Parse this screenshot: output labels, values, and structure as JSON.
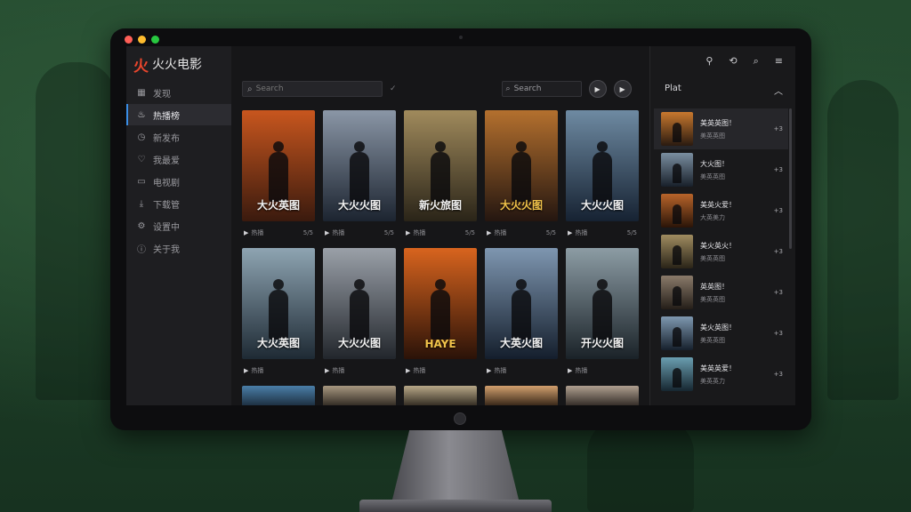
{
  "app": {
    "brand_icon": "flame-logo-icon",
    "brand_name": "火火电影"
  },
  "window": {
    "traffic_colors": [
      "#ff5f57",
      "#febc2e",
      "#28c840"
    ]
  },
  "sidebar": {
    "items": [
      {
        "label": "发现",
        "icon": "grid-icon",
        "active": false
      },
      {
        "label": "热播榜",
        "icon": "fire-icon",
        "active": true
      },
      {
        "label": "新发布",
        "icon": "clock-icon",
        "active": false
      },
      {
        "label": "我最爱",
        "icon": "heart-icon",
        "active": false
      },
      {
        "label": "电视剧",
        "icon": "tv-icon",
        "active": false
      },
      {
        "label": "下载管",
        "icon": "download-icon",
        "active": false
      },
      {
        "label": "设置中",
        "icon": "settings-icon",
        "active": false
      },
      {
        "label": "关于我",
        "icon": "info-icon",
        "active": false
      }
    ]
  },
  "toolbar": {
    "search_placeholder": "Search",
    "search2_placeholder": "Search",
    "check_icon": "✓"
  },
  "movies": [
    {
      "title": "大火英图",
      "meta_left": "热播",
      "meta_right": "5/5",
      "gold": false,
      "bg": [
        "#c8561e",
        "#3a1a0e"
      ]
    },
    {
      "title": "大火火图",
      "meta_left": "热播",
      "meta_right": "5/5",
      "gold": false,
      "bg": [
        "#8a96a6",
        "#1c2430"
      ]
    },
    {
      "title": "新火旅图",
      "meta_left": "热播",
      "meta_right": "5/5",
      "gold": false,
      "bg": [
        "#a08a5c",
        "#2a2418"
      ]
    },
    {
      "title": "大火火图",
      "meta_left": "热播",
      "meta_right": "5/5",
      "gold": true,
      "bg": [
        "#b4702e",
        "#241610"
      ]
    },
    {
      "title": "大火火图",
      "meta_left": "热播",
      "meta_right": "5/5",
      "gold": false,
      "bg": [
        "#6e8aa2",
        "#162232"
      ]
    },
    {
      "title": "大火英图",
      "meta_left": "热播",
      "meta_right": "",
      "gold": false,
      "bg": [
        "#8ea4b2",
        "#1e2a34"
      ]
    },
    {
      "title": "大火火图",
      "meta_left": "热播",
      "meta_right": "",
      "gold": false,
      "bg": [
        "#9aa0a8",
        "#22262c"
      ]
    },
    {
      "title": "HAYE",
      "meta_left": "热播",
      "meta_right": "",
      "gold": true,
      "bg": [
        "#d8641e",
        "#2a1208"
      ]
    },
    {
      "title": "大英火图",
      "meta_left": "热播",
      "meta_right": "",
      "gold": false,
      "bg": [
        "#7e96b0",
        "#141e2c"
      ]
    },
    {
      "title": "开火火图",
      "meta_left": "热播",
      "meta_right": "",
      "gold": false,
      "bg": [
        "#8c9ca4",
        "#1a2228"
      ]
    }
  ],
  "partial_row_bgs": [
    [
      "#4a7ea8",
      "#1a2a3a"
    ],
    [
      "#a89880",
      "#2a241e"
    ],
    [
      "#b8a888",
      "#2a241c"
    ],
    [
      "#d2a06e",
      "#2c1e12"
    ],
    [
      "#b0a090",
      "#2a2420"
    ]
  ],
  "right_panel": {
    "top_icons": [
      "pin-icon",
      "clock-icon",
      "search-icon",
      "menu-icon"
    ],
    "top_icon_glyphs": [
      "⚲",
      "⟲",
      "⌕",
      "≡"
    ],
    "heading": "Plat",
    "collapse_icon": "chevron-up-icon",
    "items": [
      {
        "title": "美英英图！",
        "sub": "美英英图",
        "num": "+3",
        "selected": true,
        "bg": [
          "#c8782e",
          "#2a1a10"
        ]
      },
      {
        "title": "大火图！",
        "sub": "美英英图",
        "num": "+3",
        "selected": false,
        "bg": [
          "#7a8ea0",
          "#18202a"
        ]
      },
      {
        "title": "美英火爱！",
        "sub": "大英美力",
        "num": "+3",
        "selected": false,
        "bg": [
          "#b8642a",
          "#2a1408"
        ]
      },
      {
        "title": "美火英火！",
        "sub": "美英英图",
        "num": "+3",
        "selected": false,
        "bg": [
          "#a08c60",
          "#2a2418"
        ]
      },
      {
        "title": "英英图！",
        "sub": "美英英图",
        "num": "+3",
        "selected": false,
        "bg": [
          "#8a7a6a",
          "#241e18"
        ]
      },
      {
        "title": "美火英图！",
        "sub": "美英英图",
        "num": "+3",
        "selected": false,
        "bg": [
          "#7e98b0",
          "#16202c"
        ]
      },
      {
        "title": "美英英爱！",
        "sub": "美英英力",
        "num": "+3",
        "selected": false,
        "bg": [
          "#6a9eb0",
          "#162630"
        ]
      }
    ]
  }
}
